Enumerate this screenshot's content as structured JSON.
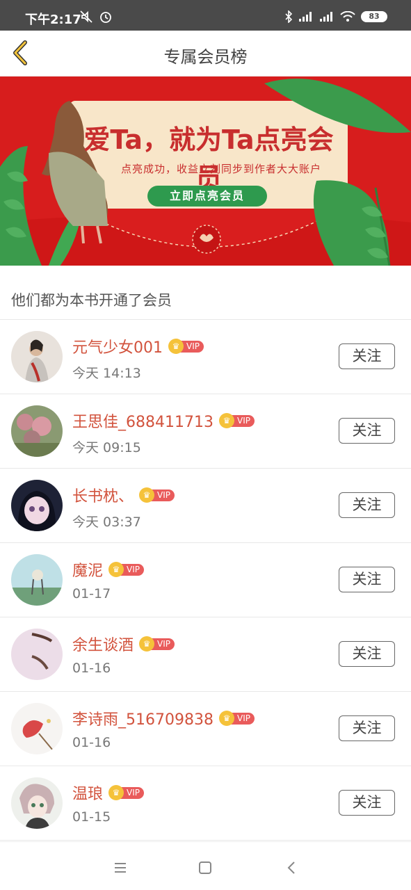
{
  "status_bar": {
    "time": "下午2:17",
    "battery": "83",
    "icons": [
      "mute-icon",
      "alarm-icon",
      "bluetooth-icon",
      "signal-icon",
      "signal-hd-icon",
      "wifi-icon"
    ]
  },
  "header": {
    "title": "专属会员榜",
    "back_icon": "chevron-left-icon"
  },
  "banner": {
    "title": "爱Ta，就为Ta点亮会员",
    "subtitle": "点亮成功，收益立刻同步到作者大大账户",
    "button": "立即点亮会员",
    "colors": {
      "background": "#d71d1d",
      "card": "#f8e6c9",
      "button": "#2e9a4e"
    }
  },
  "section": {
    "heading": "他们都为本书开通了会员"
  },
  "vip_label": "VIP",
  "follow_label": "关注",
  "members": [
    {
      "name": "元气少女001",
      "time": "今天 14:13"
    },
    {
      "name": "王思佳_688411713",
      "time": "今天 09:15"
    },
    {
      "name": "长书枕、",
      "time": "今天 03:37"
    },
    {
      "name": "魔泥",
      "time": "01-17"
    },
    {
      "name": "余生谈酒",
      "time": "01-16"
    },
    {
      "name": "李诗雨_516709838",
      "time": "01-16"
    },
    {
      "name": "温琅",
      "time": "01-15"
    }
  ],
  "nav": {
    "icons": [
      "menu-icon",
      "home-icon",
      "back-icon"
    ]
  },
  "colors": {
    "accent_name": "#d2533d",
    "vip_badge": "#e95b5b",
    "crown": "#f5c23a"
  }
}
